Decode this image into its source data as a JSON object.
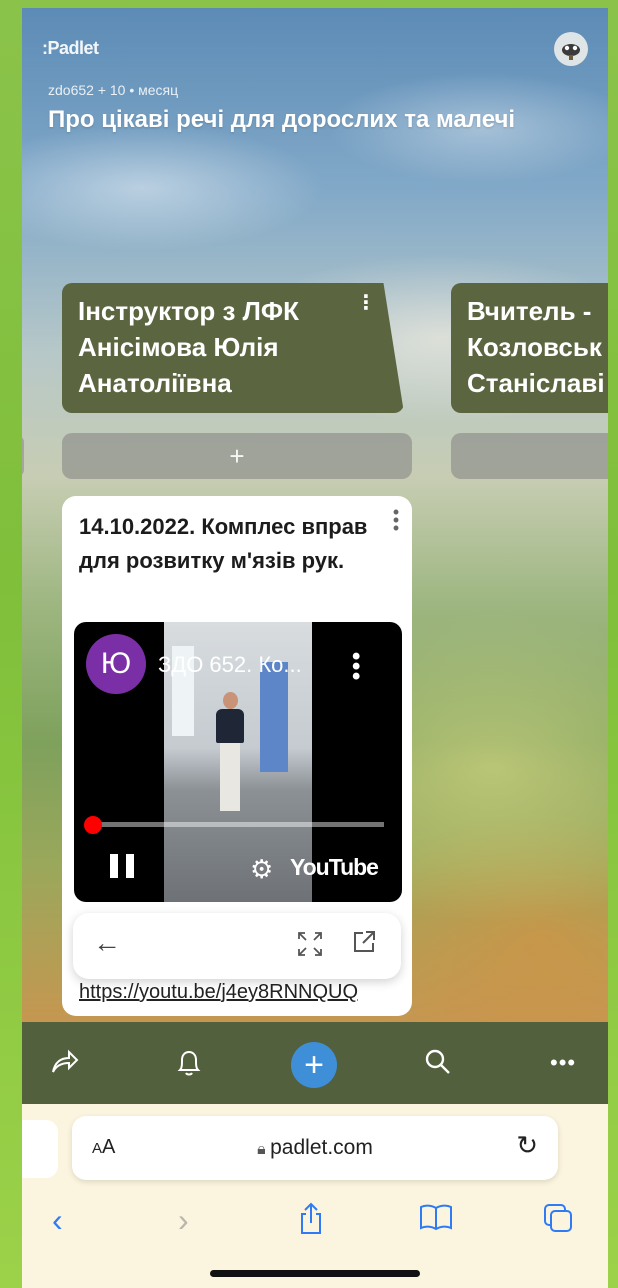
{
  "header": {
    "logo": ":Padlet",
    "meta": "zdo652 + 10 • месяц",
    "title": "Про цікаві речі для дорослих та малечі"
  },
  "columns": [
    {
      "title": "Інструктор з ЛФК Анісімова Юлія Анатоліївна",
      "lines": [
        "Інструктор з ЛФК",
        "Анісімова Юлія",
        "Анатоліївна"
      ]
    },
    {
      "title": "Вчитель - Козловськ... Станіславі...",
      "lines": [
        "Вчитель -",
        "Козловськ",
        "Станіславі"
      ]
    }
  ],
  "add_label": "+",
  "post": {
    "title": "14.10.2022. Комплес вправ для розвитку м'язів рук.",
    "url": "https://youtu.be/j4ey8RNNQUQ",
    "video": {
      "channel_initial": "Ю",
      "title": "ЗДО 652. Ко...",
      "brand": "YouTube",
      "progress": 0.02
    }
  },
  "toolbar": {
    "items": [
      "share-icon",
      "bell-icon",
      "add-icon",
      "search-icon",
      "more-icon"
    ]
  },
  "browser": {
    "text_size": "AA",
    "domain": "padlet.com",
    "icons": [
      "back-icon",
      "forward-icon",
      "share-icon",
      "bookmarks-icon",
      "tabs-icon"
    ]
  },
  "colors": {
    "column_header": "#5b6641",
    "toolbar": "#53603e",
    "add_button": "#3f8fd8",
    "browser_bar": "#fbf4de",
    "link_blue": "#2f7bf5"
  }
}
